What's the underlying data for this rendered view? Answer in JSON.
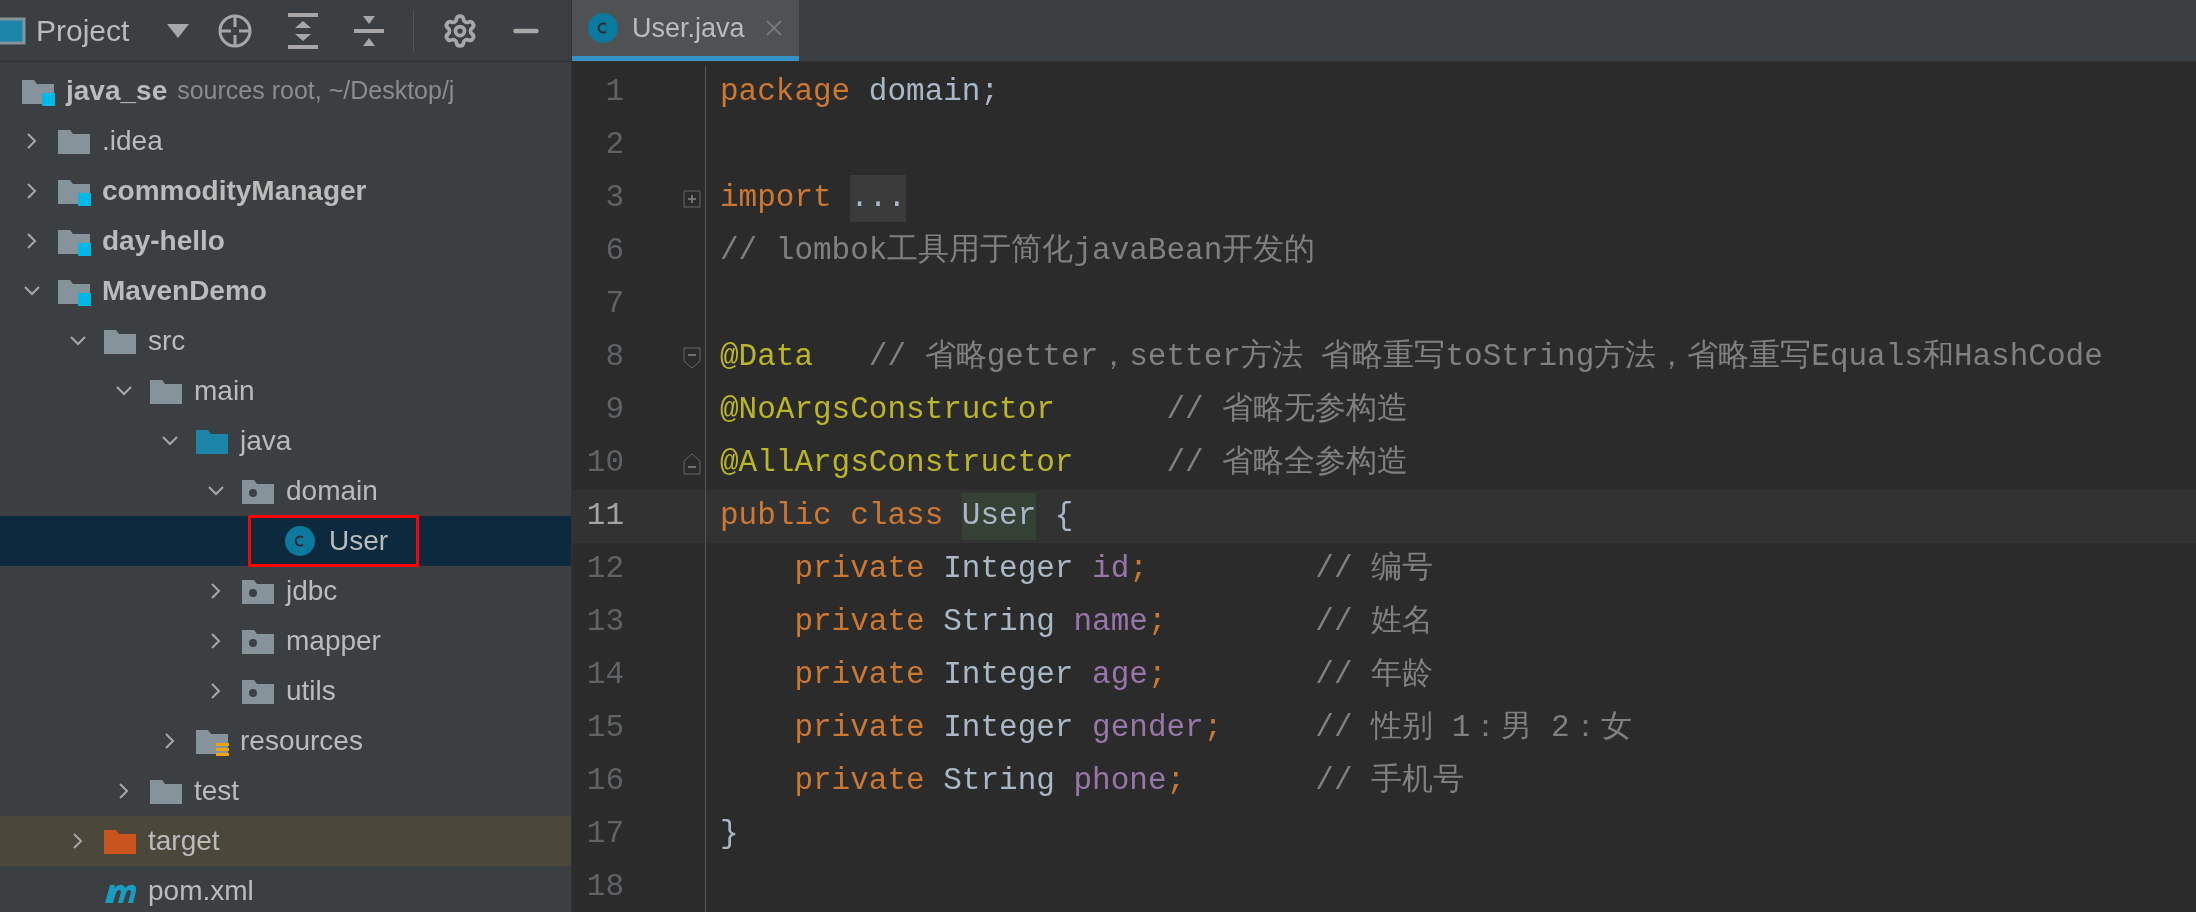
{
  "project_panel": {
    "title": "Project"
  },
  "tree": {
    "root": {
      "label": "java_se",
      "hint": "sources root,  ~/Desktop/j",
      "kind": "module",
      "selected": false,
      "children": [
        {
          "label": ".idea",
          "kind": "folder",
          "expanded": false,
          "selected": false
        },
        {
          "label": "commodityManager",
          "kind": "module",
          "expanded": false,
          "selected": false
        },
        {
          "label": "day-hello",
          "kind": "module",
          "expanded": false,
          "selected": false
        },
        {
          "label": "MavenDemo",
          "kind": "module",
          "expanded": true,
          "selected": false,
          "children": [
            {
              "label": "src",
              "kind": "folder",
              "expanded": true,
              "selected": false,
              "children": [
                {
                  "label": "main",
                  "kind": "folder",
                  "expanded": true,
                  "selected": false,
                  "children": [
                    {
                      "label": "java",
                      "kind": "source-root",
                      "expanded": true,
                      "selected": false,
                      "children": [
                        {
                          "label": "domain",
                          "kind": "package",
                          "expanded": true,
                          "selected": false,
                          "children": [
                            {
                              "label": "User",
                              "kind": "class",
                              "selected": true,
                              "annotated": true
                            }
                          ]
                        },
                        {
                          "label": "jdbc",
                          "kind": "package",
                          "expanded": false,
                          "selected": false
                        },
                        {
                          "label": "mapper",
                          "kind": "package",
                          "expanded": false,
                          "selected": false
                        },
                        {
                          "label": "utils",
                          "kind": "package",
                          "expanded": false,
                          "selected": false
                        }
                      ]
                    },
                    {
                      "label": "resources",
                      "kind": "resources",
                      "expanded": false,
                      "selected": false
                    }
                  ]
                },
                {
                  "label": "test",
                  "kind": "folder",
                  "expanded": false,
                  "selected": false
                }
              ]
            },
            {
              "label": "target",
              "kind": "excluded",
              "expanded": false,
              "selected": false
            },
            {
              "label": "pom.xml",
              "kind": "maven",
              "selected": false
            }
          ]
        }
      ]
    }
  },
  "editor_tabs": [
    {
      "label": "User.java",
      "selected": true
    }
  ],
  "code_lines": [
    {
      "number": "1",
      "current": false,
      "indented": false,
      "tokens": [
        {
          "kind": "keyword",
          "text": "package"
        },
        {
          "kind": "plain",
          "text": " domain;"
        }
      ]
    },
    {
      "number": "2",
      "current": false
    },
    {
      "number": "3",
      "current": false,
      "indented": false,
      "fold": {
        "kind": "expand"
      },
      "tokens": [
        {
          "kind": "keyword",
          "text": "import "
        },
        {
          "kind": "folded",
          "text": "..."
        }
      ]
    },
    {
      "number": "6",
      "current": false,
      "indented": false,
      "tokens": [
        {
          "kind": "comment",
          "text": "// lombok工具用于简化javaBean开发的"
        }
      ]
    },
    {
      "number": "7",
      "current": false
    },
    {
      "number": "8",
      "current": false,
      "indented": false,
      "fold": {
        "kind": "start"
      },
      "tokens": [
        {
          "kind": "annotation",
          "text": "@Data"
        },
        {
          "kind": "comment",
          "text": "   // 省略getter，setter方法 省略重写toString方法，省略重写Equals和HashCode"
        }
      ]
    },
    {
      "number": "9",
      "current": false,
      "indented": false,
      "tokens": [
        {
          "kind": "annotation",
          "text": "@NoArgsConstructor"
        },
        {
          "kind": "comment",
          "text": "      // 省略无参构造"
        }
      ]
    },
    {
      "number": "10",
      "current": false,
      "indented": false,
      "fold": {
        "kind": "end"
      },
      "tokens": [
        {
          "kind": "annotation",
          "text": "@AllArgsConstructor"
        },
        {
          "kind": "comment",
          "text": "     // 省略全参构造"
        }
      ]
    },
    {
      "number": "11",
      "current": true,
      "indented": false,
      "tokens": [
        {
          "kind": "keyword",
          "text": "public class "
        },
        {
          "kind": "usage",
          "text": "User"
        },
        {
          "kind": "plain",
          "text": " {"
        }
      ]
    },
    {
      "number": "12",
      "current": false,
      "indented": true,
      "tokens": [
        {
          "kind": "keyword",
          "text": "private"
        },
        {
          "kind": "plain",
          "text": " Integer "
        },
        {
          "kind": "field",
          "text": "id"
        },
        {
          "kind": "keyword",
          "text": ";"
        },
        {
          "kind": "comment",
          "text": "         // 编号"
        }
      ]
    },
    {
      "number": "13",
      "current": false,
      "indented": true,
      "tokens": [
        {
          "kind": "keyword",
          "text": "private"
        },
        {
          "kind": "plain",
          "text": " String "
        },
        {
          "kind": "field",
          "text": "name"
        },
        {
          "kind": "keyword",
          "text": ";"
        },
        {
          "kind": "comment",
          "text": "        // 姓名"
        }
      ]
    },
    {
      "number": "14",
      "current": false,
      "indented": true,
      "tokens": [
        {
          "kind": "keyword",
          "text": "private"
        },
        {
          "kind": "plain",
          "text": " Integer "
        },
        {
          "kind": "field",
          "text": "age"
        },
        {
          "kind": "keyword",
          "text": ";"
        },
        {
          "kind": "comment",
          "text": "        // 年龄"
        }
      ]
    },
    {
      "number": "15",
      "current": false,
      "indented": true,
      "tokens": [
        {
          "kind": "keyword",
          "text": "private"
        },
        {
          "kind": "plain",
          "text": " Integer "
        },
        {
          "kind": "field",
          "text": "gender"
        },
        {
          "kind": "keyword",
          "text": ";"
        },
        {
          "kind": "comment",
          "text": "     // 性别 1：男 2：女"
        }
      ]
    },
    {
      "number": "16",
      "current": false,
      "indented": true,
      "tokens": [
        {
          "kind": "keyword",
          "text": "private"
        },
        {
          "kind": "plain",
          "text": " String "
        },
        {
          "kind": "field",
          "text": "phone"
        },
        {
          "kind": "keyword",
          "text": ";"
        },
        {
          "kind": "comment",
          "text": "       // 手机号"
        }
      ]
    },
    {
      "number": "17",
      "current": false,
      "indented": false,
      "tokens": [
        {
          "kind": "plain",
          "text": "}"
        }
      ]
    },
    {
      "number": "18",
      "current": false
    }
  ]
}
